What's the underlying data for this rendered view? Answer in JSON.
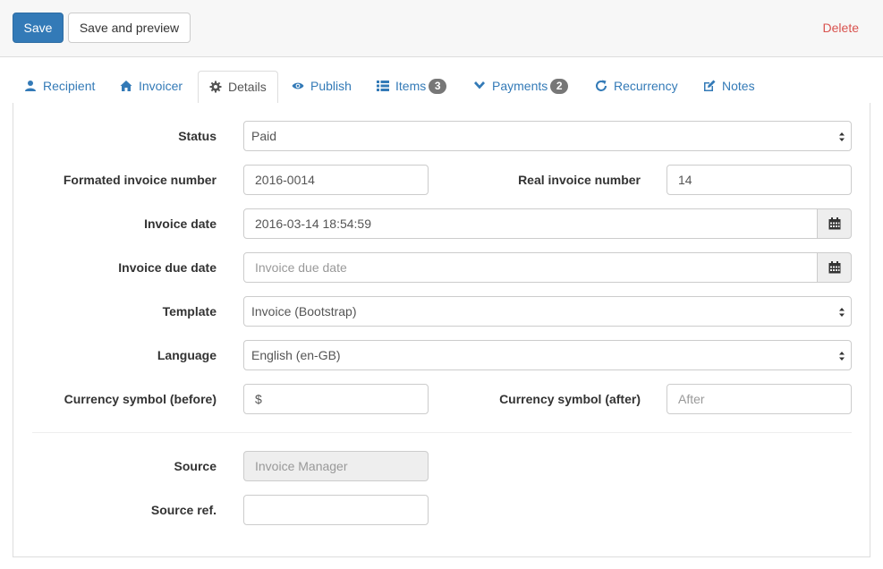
{
  "toolbar": {
    "save_label": "Save",
    "save_preview_label": "Save and preview",
    "delete_label": "Delete"
  },
  "tabs": [
    {
      "label": "Recipient",
      "icon": "user-icon"
    },
    {
      "label": "Invoicer",
      "icon": "home-icon"
    },
    {
      "label": "Details",
      "icon": "gear-icon",
      "active": true
    },
    {
      "label": "Publish",
      "icon": "eye-icon"
    },
    {
      "label": "Items",
      "icon": "list-icon",
      "badge": "3"
    },
    {
      "label": "Payments",
      "icon": "chevron-down-icon",
      "badge": "2"
    },
    {
      "label": "Recurrency",
      "icon": "refresh-icon"
    },
    {
      "label": "Notes",
      "icon": "edit-icon"
    }
  ],
  "form": {
    "status": {
      "label": "Status",
      "value": "Paid"
    },
    "formatted_number": {
      "label": "Formated invoice number",
      "value": "2016-0014"
    },
    "real_number": {
      "label": "Real invoice number",
      "value": "14"
    },
    "invoice_date": {
      "label": "Invoice date",
      "value": "2016-03-14 18:54:59"
    },
    "due_date": {
      "label": "Invoice due date",
      "placeholder": "Invoice due date"
    },
    "template": {
      "label": "Template",
      "value": "Invoice (Bootstrap)"
    },
    "language": {
      "label": "Language",
      "value": "English (en-GB)"
    },
    "currency_before": {
      "label": "Currency symbol (before)",
      "value": "$"
    },
    "currency_after": {
      "label": "Currency symbol (after)",
      "placeholder": "After"
    },
    "source": {
      "label": "Source",
      "value": "Invoice Manager"
    },
    "source_ref": {
      "label": "Source ref.",
      "value": ""
    }
  },
  "colors": {
    "primary": "#337ab7",
    "danger": "#d9534f",
    "badge": "#777777"
  }
}
